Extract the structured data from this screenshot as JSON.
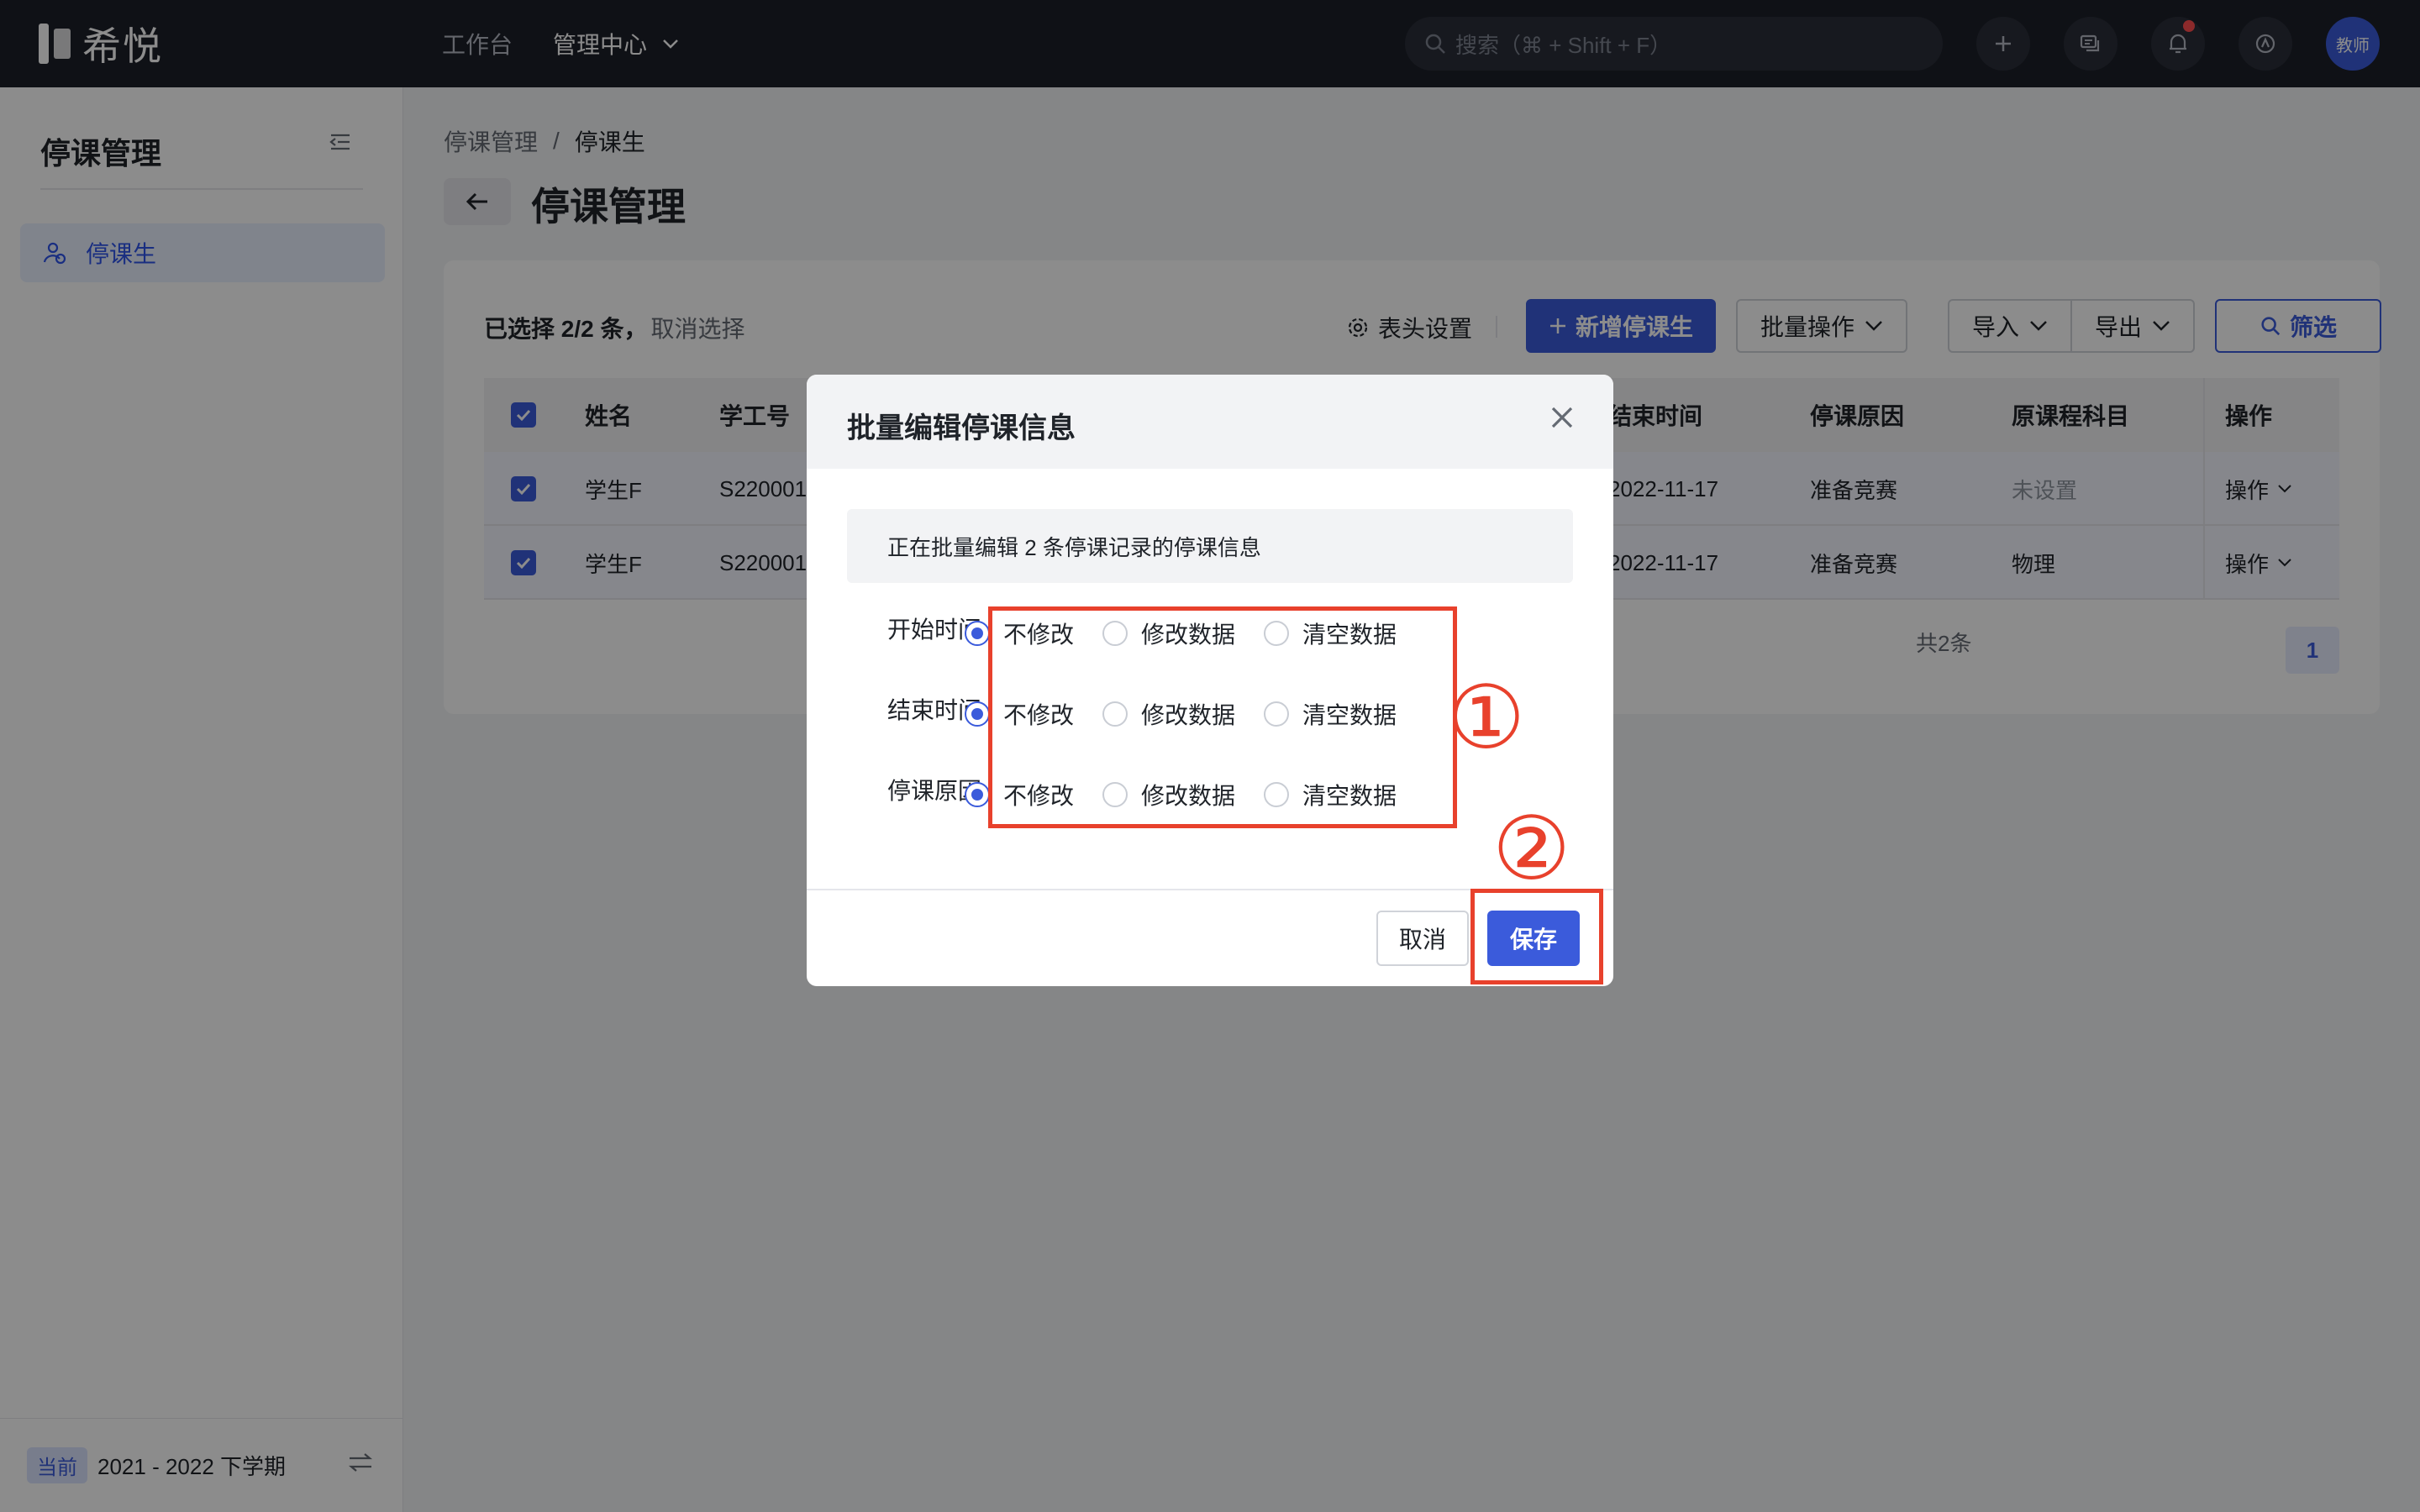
{
  "topbar": {
    "logo_text": "希悦",
    "nav": [
      "工作台",
      "管理中心"
    ],
    "search_placeholder": "搜索（⌘ + Shift + F）",
    "avatar_label": "教师"
  },
  "sidebar": {
    "title": "停课管理",
    "items": [
      {
        "label": "停课生",
        "icon": "users-icon"
      }
    ],
    "term_badge": "当前",
    "term": "2021 - 2022 下学期"
  },
  "breadcrumb": [
    "停课管理",
    "停课生"
  ],
  "page_title": "停课管理",
  "toolbar": {
    "selection": "已选择 2/2 条，",
    "cancel_selection": "取消选择",
    "header_settings": "表头设置",
    "add": "新增停课生",
    "batch": "批量操作",
    "import": "导入",
    "export": "导出",
    "filter": "筛选"
  },
  "table": {
    "columns": [
      "姓名",
      "学工号",
      "结束时间",
      "停课原因",
      "原课程科目",
      "操作"
    ],
    "rows": [
      {
        "name": "学生F",
        "id": "S220001",
        "end": "2022-11-17",
        "reason": "准备竞赛",
        "subject": "未设置",
        "action": "操作"
      },
      {
        "name": "学生F",
        "id": "S220001",
        "end": "2022-11-17",
        "reason": "准备竞赛",
        "subject": "物理",
        "action": "操作"
      }
    ],
    "total": "共2条",
    "page": "1"
  },
  "modal": {
    "title": "批量编辑停课信息",
    "notice": "正在批量编辑 2 条停课记录的停课信息",
    "fields": [
      {
        "label": "开始时间",
        "selected": 0
      },
      {
        "label": "结束时间",
        "selected": 0
      },
      {
        "label": "停课原因",
        "selected": 0
      }
    ],
    "options": [
      "不修改",
      "修改数据",
      "清空数据"
    ],
    "cancel": "取消",
    "save": "保存"
  },
  "annotations": [
    "①",
    "②"
  ],
  "colors": {
    "accent": "#3b5bdb",
    "annotation": "#e8412c",
    "topbar": "#1d2029"
  }
}
